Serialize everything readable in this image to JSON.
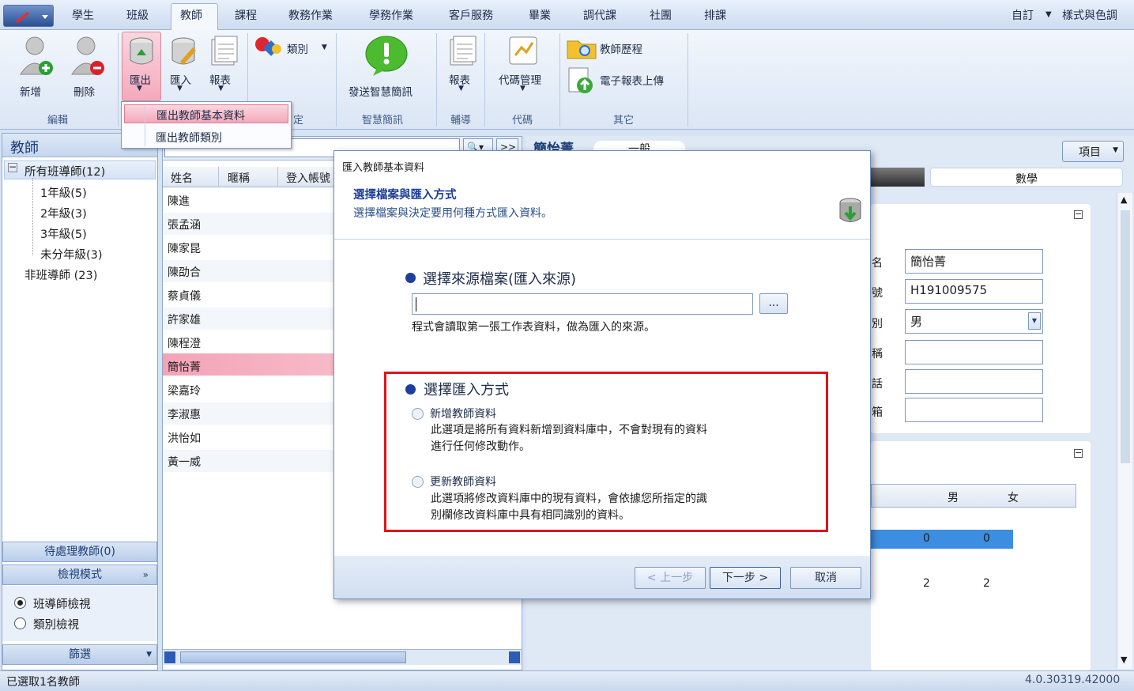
{
  "menubar": {
    "tabs": [
      "學生",
      "班級",
      "教師",
      "課程",
      "教務作業",
      "學務作業",
      "客戶服務",
      "畢業",
      "調代課",
      "社團",
      "排課"
    ],
    "active_tab": "教師",
    "right_custom": "自訂",
    "right_style": "樣式與色調"
  },
  "ribbon": {
    "add": "新增",
    "delete": "刪除",
    "group_edit": "編輯",
    "export": "匯出",
    "import": "匯入",
    "report": "報表",
    "category": "類別",
    "group_partial": "定",
    "send_sms": "發送智慧簡訊",
    "group_sms": "智慧簡訊",
    "report2": "報表",
    "group_tutor": "輔導",
    "code_manage": "代碼管理",
    "group_code": "代碼",
    "teacher_history": "教師歷程",
    "e_report_upload": "電子報表上傳",
    "group_other": "其它"
  },
  "export_menu": {
    "item1": "匯出教師基本資料",
    "item2": "匯出教師類別"
  },
  "left_panel": {
    "title": "教師",
    "tree_root": "所有班導師(12)",
    "tree_children": [
      "1年級(5)",
      "2年級(3)",
      "3年級(5)",
      "未分年級(3)"
    ],
    "non_homeroom": "非班導師 (23)",
    "pending": "待處理教師(0)",
    "view_mode": "檢視模式",
    "view_homeroom": "班導師檢視",
    "view_category": "類別檢視",
    "filter": "篩選"
  },
  "mid_panel": {
    "columns": [
      "姓名",
      "暱稱",
      "登入帳號"
    ],
    "rows": [
      "陳進",
      "張孟涵",
      "陳家昆",
      "陳劭合",
      "蔡貞儀",
      "許家雄",
      "陳程澄",
      "簡怡菁",
      "梁嘉玲",
      "李淑惠",
      "洪怡如",
      "黃一威"
    ],
    "selected_index": 7
  },
  "right_panel": {
    "header_name": "簡怡菁",
    "header_tab": "一般",
    "items_button": "項目",
    "subject": "數學",
    "labels": [
      "名",
      "號",
      "別",
      "稱",
      "話",
      "箱"
    ],
    "name_value": "簡怡菁",
    "id_value": "H191009575",
    "gender_value": "男",
    "col_male": "男",
    "col_female": "女",
    "row1_male": "0",
    "row1_female": "0",
    "row2_male": "2",
    "row2_female": "2"
  },
  "dialog": {
    "title": "匯入教師基本資料",
    "header_title": "選擇檔案與匯入方式",
    "header_sub": "選擇檔案與決定要用何種方式匯入資料。",
    "source_heading": "選擇來源檔案(匯入來源)",
    "browse_label": "...",
    "source_note": "程式會讀取第一張工作表資料，做為匯入的來源。",
    "method_heading": "選擇匯入方式",
    "opt_add": "新增教師資料",
    "opt_add_desc1": "此選項是將所有資料新增到資料庫中，不會對現有的資料",
    "opt_add_desc2": "進行任何修改動作。",
    "opt_update": "更新教師資料",
    "opt_update_desc1": "此選項將修改資料庫中的現有資料，會依據您所指定的識",
    "opt_update_desc2": "別欄修改資料庫中具有相同識別的資料。",
    "btn_prev": "< 上一步",
    "btn_next": "下一步 >",
    "btn_cancel": "取消"
  },
  "statusbar": {
    "left": "已選取1名教師",
    "version": "4.0.30319.42000"
  },
  "colors": {
    "accent_red": "#e0141b",
    "selected_row": "#f6b8c8",
    "header_blue": "#1d3f78"
  }
}
